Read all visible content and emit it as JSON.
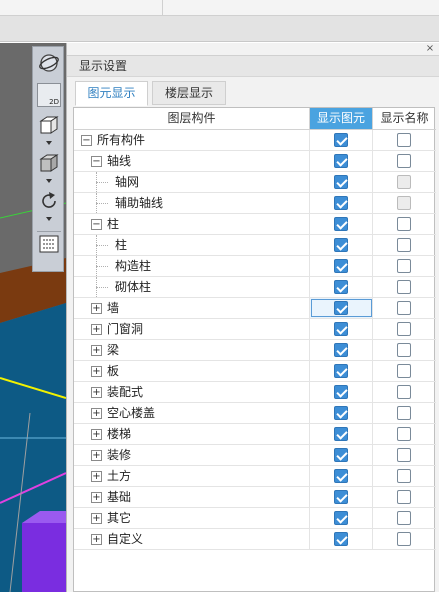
{
  "panel": {
    "title": "显示设置",
    "close_icon": "×"
  },
  "tabs": [
    {
      "label": "图元显示",
      "active": true
    },
    {
      "label": "楼层显示",
      "active": false
    }
  ],
  "table": {
    "headers": [
      "图层构件",
      "显示图元",
      "显示名称"
    ],
    "selected_header": 1,
    "rows": [
      {
        "label": "所有构件",
        "level": 0,
        "expander": "−",
        "show": true,
        "name": false,
        "name_disabled": false
      },
      {
        "label": "轴线",
        "level": 1,
        "expander": "−",
        "show": true,
        "name": false,
        "name_disabled": false
      },
      {
        "label": "轴网",
        "level": 2,
        "expander": "",
        "show": true,
        "name": false,
        "name_disabled": true
      },
      {
        "label": "辅助轴线",
        "level": 2,
        "expander": "",
        "show": true,
        "name": false,
        "name_disabled": true
      },
      {
        "label": "柱",
        "level": 1,
        "expander": "−",
        "show": true,
        "name": false,
        "name_disabled": false
      },
      {
        "label": "柱",
        "level": 2,
        "expander": "",
        "show": true,
        "name": false,
        "name_disabled": false
      },
      {
        "label": "构造柱",
        "level": 2,
        "expander": "",
        "show": true,
        "name": false,
        "name_disabled": false
      },
      {
        "label": "砌体柱",
        "level": 2,
        "expander": "",
        "show": true,
        "name": false,
        "name_disabled": false
      },
      {
        "label": "墙",
        "level": 1,
        "expander": "+",
        "show": true,
        "name": false,
        "name_disabled": false,
        "focused": true
      },
      {
        "label": "门窗洞",
        "level": 1,
        "expander": "+",
        "show": true,
        "name": false,
        "name_disabled": false
      },
      {
        "label": "梁",
        "level": 1,
        "expander": "+",
        "show": true,
        "name": false,
        "name_disabled": false
      },
      {
        "label": "板",
        "level": 1,
        "expander": "+",
        "show": true,
        "name": false,
        "name_disabled": false
      },
      {
        "label": "装配式",
        "level": 1,
        "expander": "+",
        "show": true,
        "name": false,
        "name_disabled": false
      },
      {
        "label": "空心楼盖",
        "level": 1,
        "expander": "+",
        "show": true,
        "name": false,
        "name_disabled": false
      },
      {
        "label": "楼梯",
        "level": 1,
        "expander": "+",
        "show": true,
        "name": false,
        "name_disabled": false
      },
      {
        "label": "装修",
        "level": 1,
        "expander": "+",
        "show": true,
        "name": false,
        "name_disabled": false
      },
      {
        "label": "土方",
        "level": 1,
        "expander": "+",
        "show": true,
        "name": false,
        "name_disabled": false
      },
      {
        "label": "基础",
        "level": 1,
        "expander": "+",
        "show": true,
        "name": false,
        "name_disabled": false
      },
      {
        "label": "其它",
        "level": 1,
        "expander": "+",
        "show": true,
        "name": false,
        "name_disabled": false
      },
      {
        "label": "自定义",
        "level": 1,
        "expander": "+",
        "show": true,
        "name": false,
        "name_disabled": false
      }
    ]
  },
  "toolstrip": {
    "tools": [
      "orbit-icon",
      "2d-view-icon",
      "3d-box-icon",
      "solid-box-icon",
      "rotate-icon",
      "layer-list-icon"
    ],
    "label_2d": "2D"
  },
  "colors": {
    "accent": "#3d8ed6",
    "header_selected": "#4aa3e0",
    "tab_active_text": "#2f7fc0"
  }
}
